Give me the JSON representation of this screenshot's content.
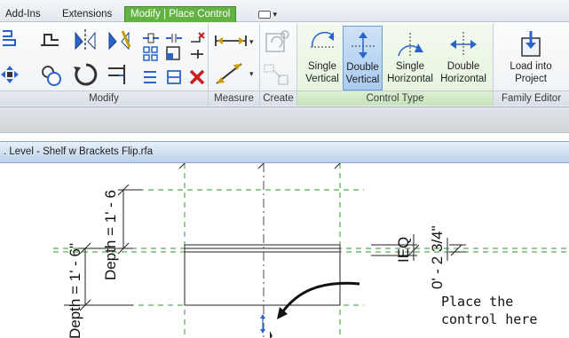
{
  "tabs": {
    "addins": "Add-Ins",
    "extensions": "Extensions",
    "active": "Modify | Place Control"
  },
  "ribbon": {
    "modify": {
      "title": "Modify"
    },
    "measure": {
      "title": "Measure"
    },
    "create": {
      "title": "Create"
    },
    "control_type": {
      "title": "Control Type",
      "buttons": [
        {
          "line1": "Single",
          "line2": "Vertical",
          "selected": false
        },
        {
          "line1": "Double",
          "line2": "Vertical",
          "selected": true
        },
        {
          "line1": "Single",
          "line2": "Horizontal",
          "selected": false
        },
        {
          "line1": "Double",
          "line2": "Horizontal",
          "selected": false
        }
      ]
    },
    "family_editor": {
      "title": "Family Editor",
      "load": {
        "line1": "Load into",
        "line2": "Project"
      }
    }
  },
  "view": {
    "title": ". Level - Shelf w Brackets Flip.rfa"
  },
  "drawing": {
    "dim_left": "Depth = 1' - 6\"",
    "dim_mid": "Depth = 1' - 6",
    "eq": "IEQ",
    "dim_right": "0' - 2 3/4\"",
    "callout_line1": "Place the",
    "callout_line2": "control here"
  },
  "colors": {
    "accent_tab": "#62b341",
    "selected_button": "#a9cbef",
    "ref_plane": "#2f9a2f",
    "control_arrow": "#2a64c8"
  }
}
